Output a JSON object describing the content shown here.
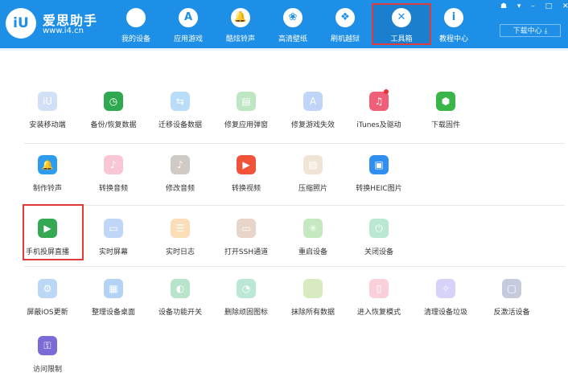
{
  "brand": {
    "name": "爱思助手",
    "url": "www.i4.cn",
    "logo_text": "iU"
  },
  "nav": [
    {
      "label": "我的设备",
      "icon": "apple-icon",
      "glyph": ""
    },
    {
      "label": "应用游戏",
      "icon": "app-store-icon",
      "glyph": "A"
    },
    {
      "label": "酷炫铃声",
      "icon": "bell-icon",
      "glyph": "🔔"
    },
    {
      "label": "高清壁纸",
      "icon": "flower-icon",
      "glyph": "❀"
    },
    {
      "label": "刷机越狱",
      "icon": "dropbox-icon",
      "glyph": "❖"
    },
    {
      "label": "工具箱",
      "icon": "tools-icon",
      "glyph": "✕"
    },
    {
      "label": "教程中心",
      "icon": "info-icon",
      "glyph": "i"
    }
  ],
  "window_controls": "☗ ▾ – □ ✕",
  "download_center": "下载中心 ⤓",
  "tools": [
    {
      "label": "安装移动端",
      "icon": "iu-app-icon",
      "color": "#7ea7e6",
      "glyph": "iU",
      "faded": true
    },
    {
      "label": "备份/恢复数据",
      "icon": "backup-clock-icon",
      "color": "#2fa84f",
      "glyph": "◷"
    },
    {
      "label": "迁移设备数据",
      "icon": "migrate-icon",
      "color": "#39a0f0",
      "glyph": "⇆",
      "faded": true
    },
    {
      "label": "修复应用弹窗",
      "icon": "fix-popup-icon",
      "color": "#48b957",
      "glyph": "▤",
      "faded": true
    },
    {
      "label": "修复游戏失效",
      "icon": "fix-game-icon",
      "color": "#4a86e8",
      "glyph": "A",
      "faded": true
    },
    {
      "label": "iTunes及驱动",
      "icon": "itunes-icon",
      "color": "#ef5f78",
      "glyph": "♫"
    },
    {
      "label": "下载固件",
      "icon": "firmware-box-icon",
      "color": "#3ab54a",
      "glyph": "⬢"
    },
    {
      "label": "制作铃声",
      "icon": "bell-plus-icon",
      "color": "#2c9cf0",
      "glyph": "🔔"
    },
    {
      "label": "转换音频",
      "icon": "audio-convert-icon",
      "color": "#ef5f8a",
      "glyph": "♪",
      "faded": true
    },
    {
      "label": "修改音频",
      "icon": "audio-edit-icon",
      "color": "#7a6a5e",
      "glyph": "♪",
      "faded": true
    },
    {
      "label": "转换视频",
      "icon": "video-convert-icon",
      "color": "#f0533a",
      "glyph": "▶"
    },
    {
      "label": "压缩照片",
      "icon": "photo-compress-icon",
      "color": "#d7b48b",
      "glyph": "▨",
      "faded": true
    },
    {
      "label": "转换HEIC图片",
      "icon": "heic-icon",
      "color": "#2f8ef0",
      "glyph": "▣"
    },
    {
      "label": "手机投屏直播",
      "icon": "screen-cast-icon",
      "color": "#35a853",
      "glyph": "▶"
    },
    {
      "label": "实时屏幕",
      "icon": "realtime-screen-icon",
      "color": "#4a8be6",
      "glyph": "▭",
      "faded": true
    },
    {
      "label": "实时日志",
      "icon": "realtime-log-icon",
      "color": "#f1a23a",
      "glyph": "☰",
      "faded": true
    },
    {
      "label": "打开SSH通道",
      "icon": "ssh-icon",
      "color": "#b98963",
      "glyph": "▭",
      "faded": true
    },
    {
      "label": "重启设备",
      "icon": "restart-icon",
      "color": "#5fbf4e",
      "glyph": "✳",
      "faded": true
    },
    {
      "label": "关闭设备",
      "icon": "power-icon",
      "color": "#3cc07a",
      "glyph": "⏻",
      "faded": true
    },
    {
      "label": "屏蔽iOS更新",
      "icon": "block-update-icon",
      "color": "#3e8fe6",
      "glyph": "⚙",
      "faded": true
    },
    {
      "label": "整理设备桌面",
      "icon": "desktop-organize-icon",
      "color": "#2c7fe0",
      "glyph": "▦",
      "faded": true
    },
    {
      "label": "设备功能开关",
      "icon": "toggle-icon",
      "color": "#35b36a",
      "glyph": "◐",
      "faded": true
    },
    {
      "label": "删除顽固图标",
      "icon": "delete-icon-icon",
      "color": "#3fbf8a",
      "glyph": "◔",
      "faded": true
    },
    {
      "label": "抹除所有数据",
      "icon": "erase-apple-icon",
      "color": "#8bc34a",
      "glyph": "",
      "faded": true
    },
    {
      "label": "进入恢复模式",
      "icon": "recovery-mode-icon",
      "color": "#f07c96",
      "glyph": "▯",
      "faded": true
    },
    {
      "label": "清理设备垃圾",
      "icon": "broom-icon",
      "color": "#8e7ff0",
      "glyph": "✧",
      "faded": true
    },
    {
      "label": "反激活设备",
      "icon": "deactivate-icon",
      "color": "#5f6aa0",
      "glyph": "▢",
      "faded": true
    },
    {
      "label": "访问限制",
      "icon": "restriction-key-icon",
      "color": "#7b6bd6",
      "glyph": "⚿"
    }
  ]
}
